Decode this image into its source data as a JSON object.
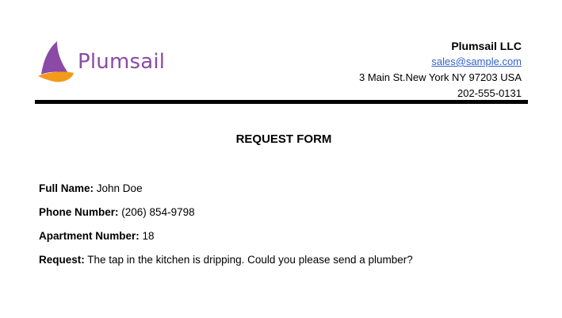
{
  "logo": {
    "text": "Plumsail",
    "colors": {
      "sail": "#8a4aa6",
      "wave": "#f39a1b"
    }
  },
  "company": {
    "name": "Plumsail LLC",
    "email": "sales@sample.com",
    "address": "3 Main St.New York NY 97203 USA",
    "phone": "202-555-0131"
  },
  "form": {
    "title": "REQUEST FORM",
    "fields": [
      {
        "label": "Full Name:",
        "value": "John Doe"
      },
      {
        "label": "Phone Number:",
        "value": "(206) 854-9798"
      },
      {
        "label": "Apartment Number:",
        "value": "18"
      },
      {
        "label": "Request:",
        "value": "The tap in the kitchen is dripping. Could you please send a plumber?"
      }
    ]
  },
  "colors": {
    "accent": "#8a4aa6",
    "link": "#2f63c8"
  }
}
